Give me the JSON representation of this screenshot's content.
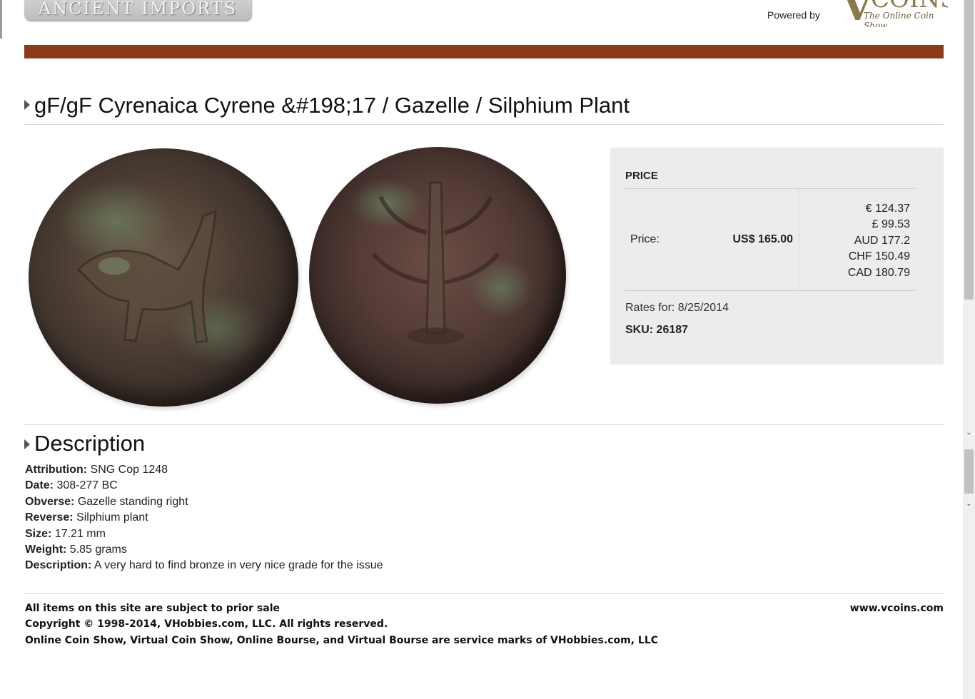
{
  "header": {
    "logo_text": "ANCIENT IMPORTS",
    "powered_label": "Powered by",
    "vcoins_logo_v": "V",
    "vcoins_logo_text": "COINS",
    "vcoins_tagline": "The Online Coin Show",
    "bar_color": "#8b3a1c"
  },
  "product": {
    "title": "gF/gF Cyrenaica Cyrene &#198;17 / Gazelle / Silphium Plant"
  },
  "price_box": {
    "heading": "PRICE",
    "price_label": "Price:",
    "price_usd": "US$ 165.00",
    "rates": [
      "€ 124.37",
      "£ 99.53",
      "AUD 177.2",
      "CHF 150.49",
      "CAD 180.79"
    ],
    "rates_date": "Rates for: 8/25/2014",
    "sku": "SKU: 26187"
  },
  "description": {
    "heading": "Description",
    "items": [
      {
        "key": "Attribution:",
        "value": " SNG Cop 1248"
      },
      {
        "key": "Date:",
        "value": " 308-277 BC"
      },
      {
        "key": "Obverse:",
        "value": " Gazelle standing right"
      },
      {
        "key": "Reverse:",
        "value": " Silphium plant"
      },
      {
        "key": "Size:",
        "value": " 17.21 mm"
      },
      {
        "key": "Weight:",
        "value": " 5.85 grams"
      },
      {
        "key": "Description:",
        "value": " A very hard to find bronze in very nice grade for the issue"
      }
    ]
  },
  "footer": {
    "lines": [
      "All items on this site are subject to prior sale",
      "Copyright © 1998-2014, VHobbies.com, LLC. All rights reserved.",
      "Online Coin Show, Virtual Coin Show, Online Bourse, and Virtual Bourse are service marks of VHobbies.com, LLC"
    ],
    "site": "www.vcoins.com"
  },
  "scrollbar": {
    "up_arrow": "⌃",
    "down_arrow": "⌄"
  }
}
